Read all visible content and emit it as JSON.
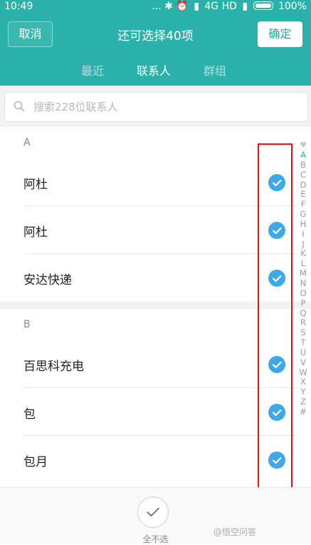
{
  "status_bar": {
    "time": "10:49",
    "indicators": "... ✱ ⏰",
    "network": "4G HD",
    "battery": "100%"
  },
  "header": {
    "cancel_label": "取消",
    "title": "还可选择40项",
    "confirm_label": "确定"
  },
  "tabs": [
    {
      "label": "最近",
      "active": false
    },
    {
      "label": "联系人",
      "active": true
    },
    {
      "label": "群组",
      "active": false
    }
  ],
  "search": {
    "placeholder": "搜索228位联系人",
    "value": ""
  },
  "sections": [
    {
      "letter": "A",
      "contacts": [
        {
          "name": "阿杜",
          "checked": true
        },
        {
          "name": "阿杜",
          "checked": true
        },
        {
          "name": "安达快递",
          "checked": true
        }
      ]
    },
    {
      "letter": "B",
      "contacts": [
        {
          "name": "百思科充电",
          "checked": true
        },
        {
          "name": "包",
          "checked": true
        },
        {
          "name": "包月",
          "checked": true
        }
      ]
    }
  ],
  "alpha_index": {
    "favorite_icon": "heart-icon",
    "letters": [
      "A",
      "B",
      "C",
      "D",
      "E",
      "F",
      "G",
      "H",
      "I",
      "J",
      "K",
      "L",
      "M",
      "N",
      "O",
      "P",
      "Q",
      "R",
      "S",
      "T",
      "U",
      "V",
      "W",
      "X",
      "Y",
      "Z",
      "#"
    ],
    "active": "A"
  },
  "bottom": {
    "deselect_label": "全不选"
  },
  "watermark": "@悟空问答",
  "colors": {
    "accent": "#2ab2aa",
    "check": "#3fa8e8",
    "highlight": "#e01818"
  }
}
